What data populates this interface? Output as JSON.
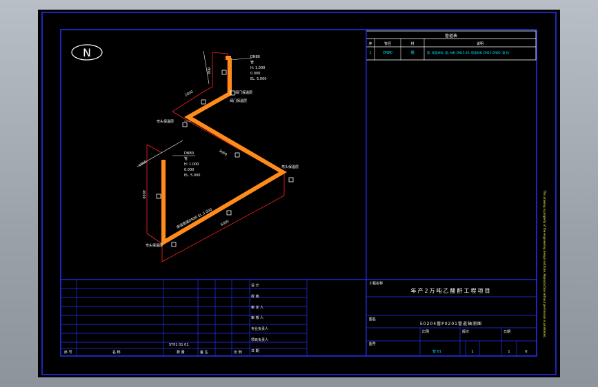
{
  "north": {
    "label": "N"
  },
  "material_table": {
    "title": "管道表",
    "headers": [
      "序",
      "管径",
      "材",
      "说明"
    ],
    "row": [
      "1",
      "DN80",
      "钢",
      "管, 保温材料, 管, 材料 DN15.20, 保温材料 DN15 DN80, 管 材"
    ]
  },
  "pipe_labels": {
    "top_riser": [
      "DN80",
      "管",
      "H: 1.000",
      "0.000",
      "EL. 5.000"
    ],
    "left_riser": [
      "DN80",
      "管",
      "H: 1.000",
      "0.000",
      "EL. 5.000"
    ],
    "valve_a": "阀门保温层",
    "valve_b": "阀门保温层",
    "elbow_mid": "弯头保温层",
    "elbow_right": "弯头保温层",
    "elbow_bottom": "弯头保温层",
    "diag_dim": "保温管道DN80 EL.5.000",
    "dim_small": "2000",
    "dim_mid": "3000",
    "dim_long": "6000",
    "dim_vert": "4000",
    "dim_left": "1500",
    "dim_top": "800"
  },
  "title_block": {
    "project": "年产2万吨乙酸酐工程项目",
    "drawing_name": "E0204管P0201管道轴测图",
    "header_label": "工程名称",
    "sub_label": "图名",
    "sign_labels": [
      "设 计",
      "校 核",
      "审 定 人",
      "审 核 人",
      "专业负责人",
      "项目负责人",
      "日 期"
    ],
    "bottom_row": [
      "序 号",
      "名 称",
      "数 量",
      "备 注",
      "比 例"
    ],
    "left_note": "ST01 01 01",
    "id_labels": [
      "图号",
      "比例",
      "版次",
      "日期"
    ],
    "id_values": [
      "管 01",
      "1",
      "1",
      "6"
    ]
  },
  "side_note": "This drawing is property of the engineering design institute. Reproduction without permission is prohibited.",
  "colors": {
    "pipe": "#ff8c1a",
    "frame": "#2233ff",
    "outline": "#ff2222"
  }
}
